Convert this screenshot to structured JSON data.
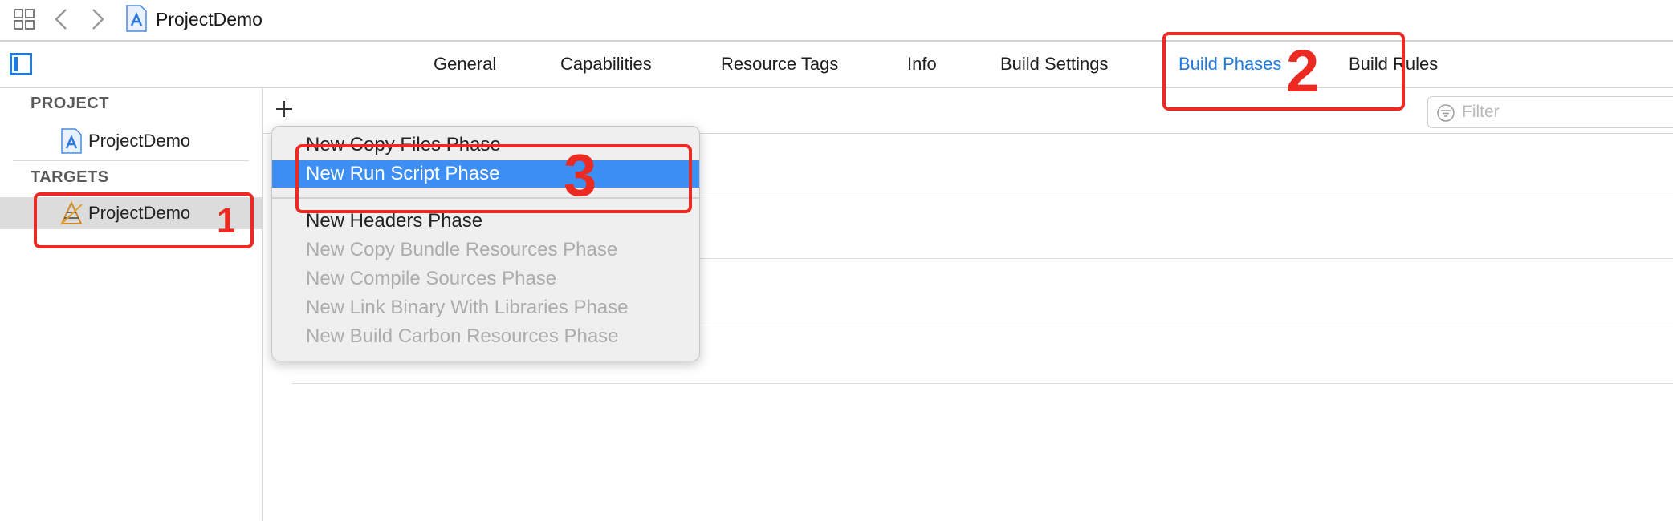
{
  "window": {
    "title": "ProjectDemo"
  },
  "tabs": [
    {
      "label": "General"
    },
    {
      "label": "Capabilities"
    },
    {
      "label": "Resource Tags"
    },
    {
      "label": "Info"
    },
    {
      "label": "Build Settings"
    },
    {
      "label": "Build Phases",
      "active": true
    },
    {
      "label": "Build Rules"
    }
  ],
  "sidebar": {
    "project_header": "PROJECT",
    "project_item": "ProjectDemo",
    "targets_header": "TARGETS",
    "target_item": "ProjectDemo",
    "target_selected": true
  },
  "toolbar": {
    "add_icon": "plus-icon",
    "filter_placeholder": "Filter",
    "filter_value": ""
  },
  "menu": {
    "items": [
      {
        "label": "New Copy Files Phase",
        "enabled": true,
        "highlighted": false
      },
      {
        "label": "New Run Script Phase",
        "enabled": true,
        "highlighted": true
      },
      {
        "label": "New Headers Phase",
        "enabled": true,
        "highlighted": false
      },
      {
        "label": "New Copy Bundle Resources Phase",
        "enabled": false,
        "highlighted": false
      },
      {
        "label": "New Compile Sources Phase",
        "enabled": false,
        "highlighted": false
      },
      {
        "label": "New Link Binary With Libraries Phase",
        "enabled": false,
        "highlighted": false
      },
      {
        "label": "New Build Carbon Resources Phase",
        "enabled": false,
        "highlighted": false
      }
    ]
  },
  "annotations": {
    "step_1": "1",
    "step_2": "2",
    "step_3": "3",
    "color": "#ec2a22"
  },
  "colors": {
    "accent": "#1f7ae0",
    "menu_highlight": "#3d8ff4",
    "sidebar_selection": "#dcdcdc"
  }
}
